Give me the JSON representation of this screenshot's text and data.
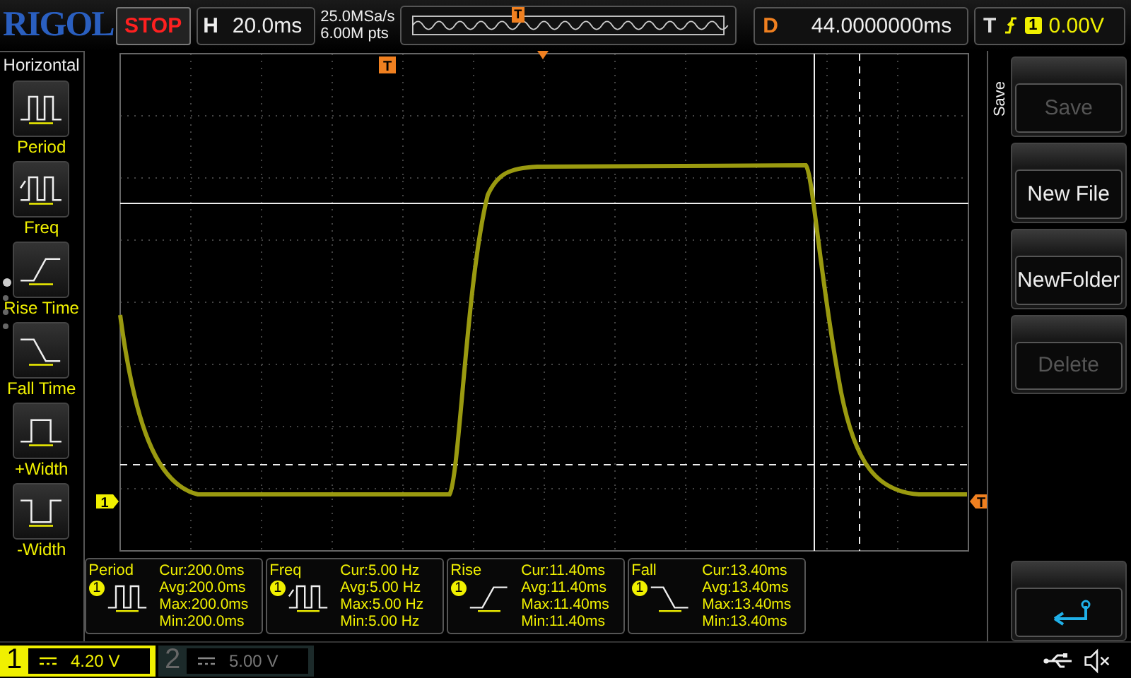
{
  "logo": "RIGOL",
  "run_state": "STOP",
  "timebase": {
    "label": "H",
    "value": "20.0ms"
  },
  "sample": {
    "rate": "25.0MSa/s",
    "depth": "6.00M pts"
  },
  "overview": {
    "marker": "T"
  },
  "delay": {
    "label": "D",
    "value": "44.0000000ms"
  },
  "trigger": {
    "label": "T",
    "source": "1",
    "level": "0.00V"
  },
  "left_menu": {
    "title": "Horizontal",
    "items": [
      {
        "label": "Period",
        "kind": "period"
      },
      {
        "label": "Freq",
        "kind": "freq"
      },
      {
        "label": "Rise Time",
        "kind": "rise"
      },
      {
        "label": "Fall Time",
        "kind": "fall"
      },
      {
        "label": "+Width",
        "kind": "pwidth"
      },
      {
        "label": "-Width",
        "kind": "nwidth"
      }
    ],
    "page_dots": [
      {
        "selected": true
      },
      {
        "selected": false
      },
      {
        "selected": false
      },
      {
        "selected": false
      }
    ]
  },
  "plot": {
    "trigger_marker": "T",
    "channel_marker": "1",
    "level_marker": "T"
  },
  "right_menu": {
    "title": "Save",
    "items": [
      {
        "kind": "text",
        "label": "Save",
        "disabled": true
      },
      {
        "kind": "text",
        "label": "New File",
        "disabled": false
      },
      {
        "kind": "text",
        "label": "NewFolder",
        "disabled": false
      },
      {
        "kind": "text",
        "label": "Delete",
        "disabled": true
      },
      {
        "kind": "back"
      }
    ]
  },
  "measurements": [
    {
      "name": "Period",
      "source": "1",
      "kind": "period",
      "lines": [
        "Cur:200.0ms",
        "Avg:200.0ms",
        "Max:200.0ms",
        "Min:200.0ms"
      ]
    },
    {
      "name": "Freq",
      "source": "1",
      "kind": "freq",
      "lines": [
        "Cur:5.00 Hz",
        "Avg:5.00 Hz",
        "Max:5.00 Hz",
        "Min:5.00 Hz"
      ]
    },
    {
      "name": "Rise",
      "source": "1",
      "kind": "rise",
      "lines": [
        "Cur:11.40ms",
        "Avg:11.40ms",
        "Max:11.40ms",
        "Min:11.40ms"
      ]
    },
    {
      "name": "Fall",
      "source": "1",
      "kind": "fall",
      "lines": [
        "Cur:13.40ms",
        "Avg:13.40ms",
        "Max:13.40ms",
        "Min:13.40ms"
      ]
    }
  ],
  "channels": [
    {
      "number": "1",
      "scale": "4.20 V",
      "on": true
    },
    {
      "number": "2",
      "scale": "5.00 V",
      "on": false
    }
  ]
}
